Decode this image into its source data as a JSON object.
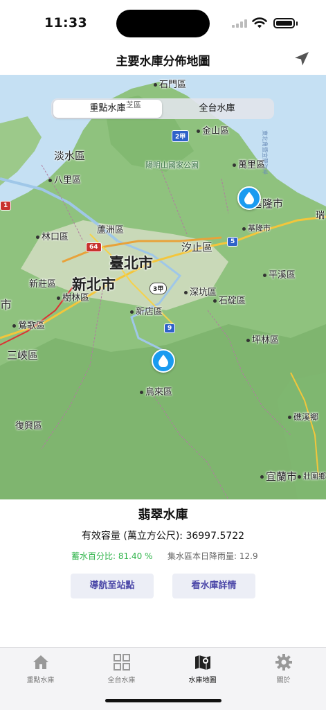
{
  "status": {
    "time": "11:33"
  },
  "nav": {
    "title": "主要水庫分佈地圖"
  },
  "map": {
    "segments": [
      "重點水庫",
      "全台水庫"
    ],
    "selected_segment": "重點水庫",
    "labels": {
      "shimen": "石門區",
      "jinshan": "金山區",
      "tamsui": "淡水區",
      "bali": "八里區",
      "yangmingshan": "陽明山國家公園",
      "wanli": "萬里區",
      "keelung": "基隆市",
      "keelung_port": "基隆市",
      "linkou": "林口區",
      "luzhou": "蘆洲區",
      "taipei": "臺北市",
      "xizhi": "汐止區",
      "newtaipei": "新北市",
      "xinzhuang": "新莊區",
      "shulin": "樹林區",
      "shenkeng": "深坑區",
      "shiding": "石碇區",
      "pingxi": "平溪區",
      "xindian": "新店區",
      "yingge": "鶯歌區",
      "sanxia": "三峽區",
      "pinglin": "坪林區",
      "wulai": "烏來區",
      "fuxing": "復興區",
      "jiaoxi": "礁溪鄉",
      "yilan": "宜蘭市",
      "zhuwei": "壯圍鄉",
      "ruifang": "瑞",
      "shi": "市",
      "zhi": "芝區"
    },
    "shields": {
      "r2": "2甲",
      "r5": "5",
      "r64": "64",
      "r3": "3甲",
      "r9": "9",
      "r1": "1"
    }
  },
  "reservoir": {
    "name": "翡翠水庫",
    "capacity": "有效容量 (萬立方公尺): 36997.5722",
    "percentage": "蓄水百分比: 81.40 %",
    "rainfall": "集水區本日降雨量: 12.9",
    "nav_button": "導航至站點",
    "detail_button": "看水庫詳情"
  },
  "tabs": [
    {
      "label": "重點水庫",
      "icon": "house-icon"
    },
    {
      "label": "全台水庫",
      "icon": "grid-icon"
    },
    {
      "label": "水庫地圖",
      "icon": "map-icon"
    },
    {
      "label": "關於",
      "icon": "gear-icon"
    }
  ],
  "colors": {
    "accent": "#4b47a8",
    "pin": "#1a9bf0",
    "percentage_green": "#2fb44a",
    "sea": "#c5e0f3",
    "land": "#8fc27e"
  }
}
